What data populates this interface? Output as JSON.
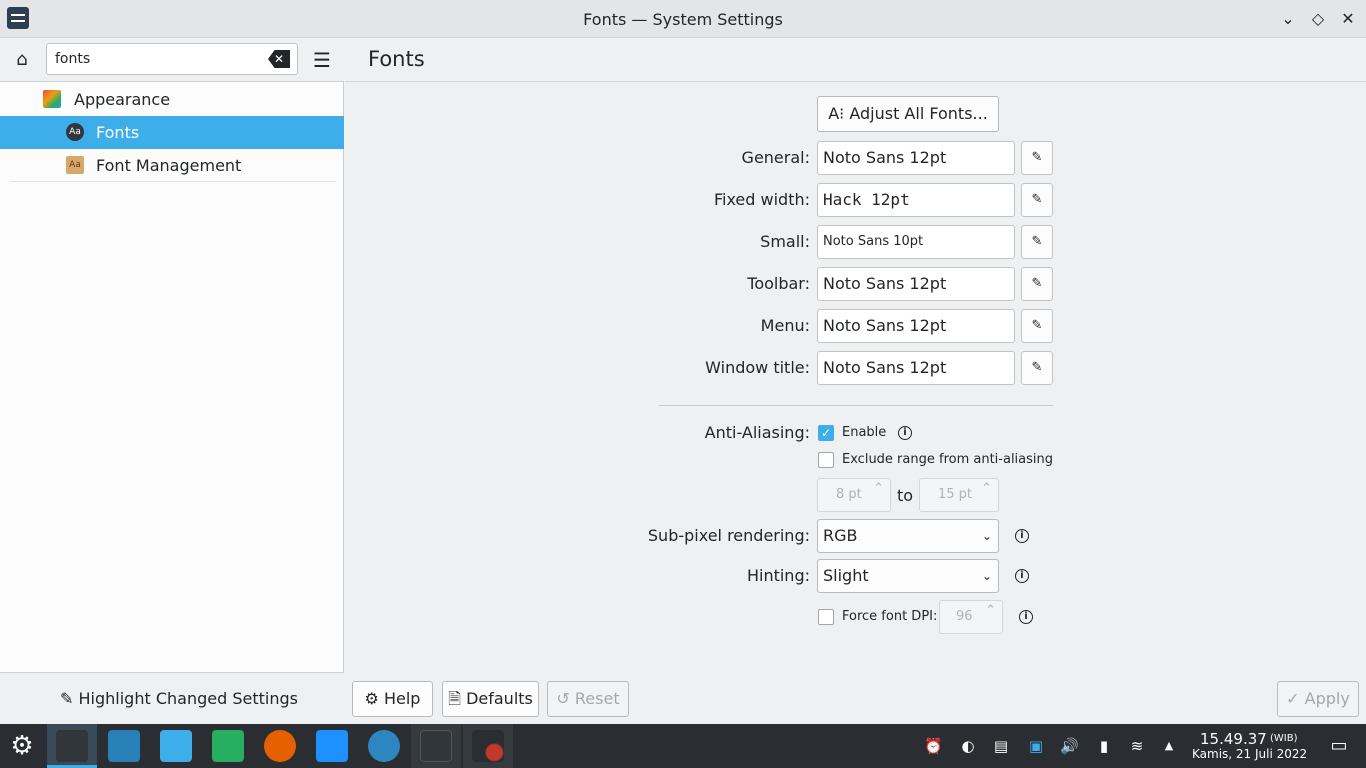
{
  "window": {
    "title": "Fonts — System Settings",
    "minimize_glyph": "⌄",
    "maximize_glyph": "◇",
    "close_glyph": "✕"
  },
  "sidebar": {
    "search_value": "fonts",
    "clear_glyph": "✕",
    "home_glyph": "⌂",
    "menu_glyph": "☰",
    "items": [
      {
        "label": "Appearance",
        "icon": "appearance-icon",
        "color": "#e74c3c"
      },
      {
        "label": "Fonts",
        "icon": "fonts-icon",
        "icon_text": "Aa",
        "selected": true
      },
      {
        "label": "Font Management",
        "icon": "font-management-icon",
        "icon_text": "Aa"
      }
    ],
    "footer_button": "Highlight Changed Settings",
    "footer_glyph": "✎"
  },
  "main": {
    "page_title": "Fonts",
    "adjust_all": "Adjust All Fonts...",
    "adjust_glyph": "A⁝",
    "edit_glyph": "✎",
    "rows": [
      {
        "label": "General:",
        "value": "Noto Sans 12pt"
      },
      {
        "label": "Fixed width:",
        "value": "Hack 12pt"
      },
      {
        "label": "Small:",
        "value": "Noto Sans 10pt"
      },
      {
        "label": "Toolbar:",
        "value": "Noto Sans 12pt"
      },
      {
        "label": "Menu:",
        "value": "Noto Sans 12pt"
      },
      {
        "label": "Window title:",
        "value": "Noto Sans 12pt"
      }
    ],
    "anti_aliasing": {
      "label": "Anti-Aliasing:",
      "enable_label": "Enable",
      "enabled": true,
      "exclude_label": "Exclude range from anti-aliasing",
      "exclude_checked": false,
      "range_from": "8 pt",
      "range_to_label": "to",
      "range_to": "15 pt"
    },
    "subpixel": {
      "label": "Sub-pixel rendering:",
      "value": "RGB"
    },
    "hinting": {
      "label": "Hinting:",
      "value": "Slight"
    },
    "force_dpi": {
      "label": "Force font DPI:",
      "value": "96",
      "checked": false
    },
    "info_glyph": "i",
    "check_glyph": "✓",
    "dropdown_glyph": "⌄",
    "spin_glyph": "⌃"
  },
  "bottom": {
    "help": "Help",
    "help_glyph": "⚙",
    "defaults": "Defaults",
    "defaults_glyph": "🗎",
    "reset": "Reset",
    "reset_glyph": "↺",
    "apply": "Apply",
    "apply_glyph": "✓"
  },
  "taskbar": {
    "launcher_glyph": "⚙",
    "apps": [
      {
        "name": "system-settings-task",
        "color": "#31363b"
      },
      {
        "name": "discover-task",
        "color": "#2980b9"
      },
      {
        "name": "file-manager-task",
        "color": "#3daee9"
      },
      {
        "name": "spreadsheet-task",
        "color": "#27ae60"
      },
      {
        "name": "firefox-task",
        "color": "#e66000"
      },
      {
        "name": "document-task",
        "color": "#1e90ff"
      },
      {
        "name": "mail-task",
        "color": "#2e86c1"
      },
      {
        "name": "terminal-task",
        "color": "#31363b"
      },
      {
        "name": "molecule-app-task",
        "color": "#c0392b"
      }
    ],
    "tray_glyphs": [
      "⏰",
      "◐",
      "▤",
      "▣",
      "🔊",
      "▮",
      "≋",
      "▲"
    ],
    "time": "15.49.37",
    "timezone": "(WIB)",
    "date": "Kamis, 21 Juli 2022",
    "show_desktop_glyph": "▭"
  }
}
